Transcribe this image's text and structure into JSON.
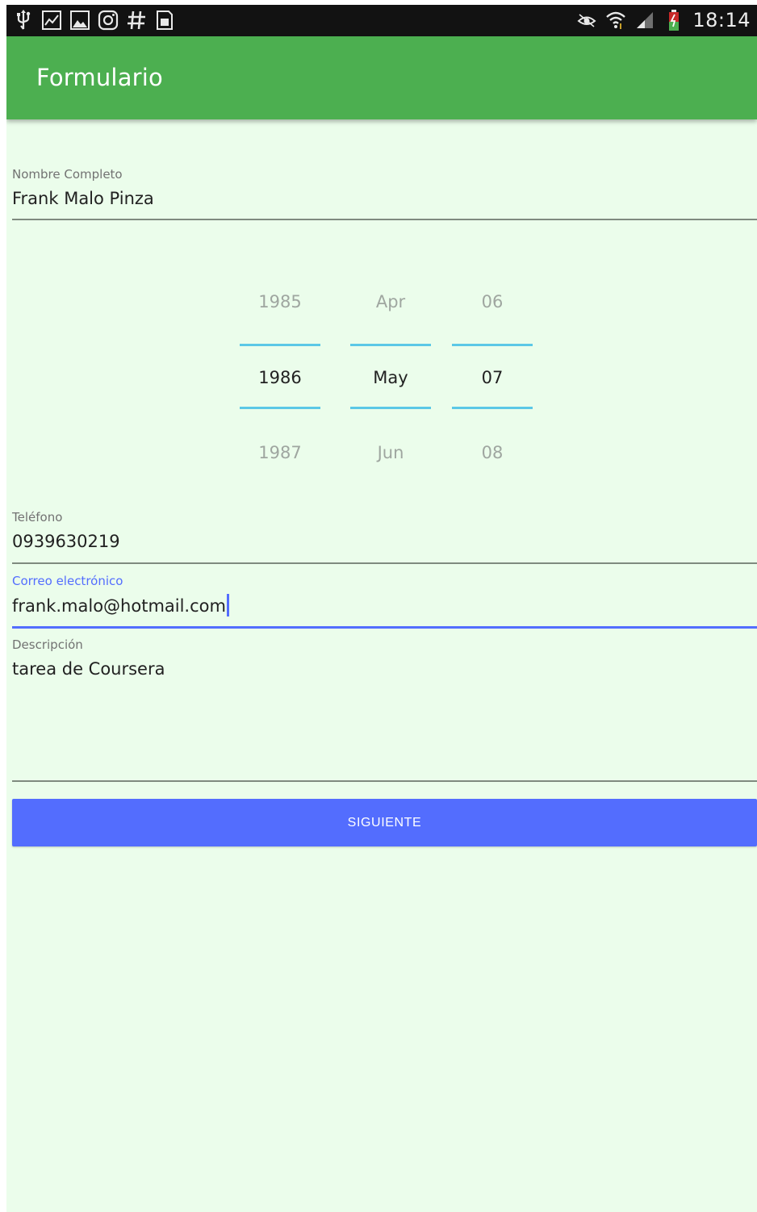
{
  "status_bar": {
    "time": "18:14",
    "left_icons": [
      "usb-icon",
      "chart-icon",
      "image-icon",
      "instagram-icon",
      "hash-icon",
      "sim-card-icon"
    ],
    "right_icons": [
      "eye-icon",
      "wifi-icon",
      "signal-icon",
      "battery-icon"
    ]
  },
  "app_bar": {
    "title": "Formulario",
    "color": "#4caf50"
  },
  "form": {
    "nombre": {
      "label": "Nombre Completo",
      "value": "Frank Malo Pinza"
    },
    "date_picker": {
      "year": {
        "prev": "1985",
        "selected": "1986",
        "next": "1987"
      },
      "month": {
        "prev": "Apr",
        "selected": "May",
        "next": "Jun"
      },
      "day": {
        "prev": "06",
        "selected": "07",
        "next": "08"
      }
    },
    "telefono": {
      "label": "Teléfono",
      "value": "0939630219"
    },
    "correo": {
      "label": "Correo electrónico",
      "value": "frank.malo@hotmail.com"
    },
    "descripcion": {
      "label": "Descripción",
      "value": "tarea de Coursera"
    },
    "submit_label": "SIGUIENTE"
  },
  "colors": {
    "background": "#ebfdeb",
    "accent": "#536dfe",
    "picker_divider": "#5bc8e6"
  }
}
